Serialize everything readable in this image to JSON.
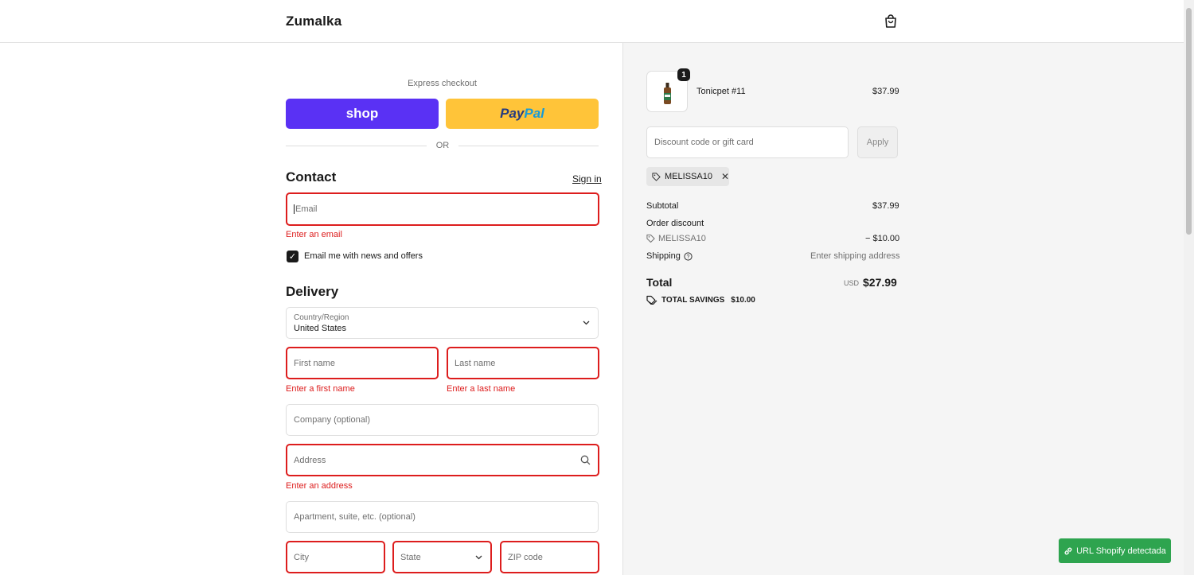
{
  "header": {
    "brand": "Zumalka",
    "cart_icon": "shopping-bag-icon"
  },
  "express": {
    "title": "Express checkout",
    "shop_label": "shop",
    "paypal_part1": "Pay",
    "paypal_part2": "Pal",
    "or_label": "OR"
  },
  "contact": {
    "heading": "Contact",
    "signin": "Sign in",
    "email_placeholder": "Email",
    "email_error": "Enter an email",
    "newsletter_label": "Email me with news and offers",
    "newsletter_checked": true
  },
  "delivery": {
    "heading": "Delivery",
    "country_label": "Country/Region",
    "country_value": "United States",
    "first_name": "First name",
    "first_name_error": "Enter a first name",
    "last_name": "Last name",
    "last_name_error": "Enter a last name",
    "company": "Company (optional)",
    "address": "Address",
    "address_error": "Enter an address",
    "apartment": "Apartment, suite, etc. (optional)",
    "city": "City",
    "state": "State",
    "zip": "ZIP code"
  },
  "summary": {
    "item": {
      "name": "Tonicpet #11",
      "price": "$37.99",
      "quantity": "1"
    },
    "discount_placeholder": "Discount code or gift card",
    "apply_label": "Apply",
    "applied_code": "MELISSA10",
    "subtotal_label": "Subtotal",
    "subtotal_value": "$37.99",
    "order_discount_label": "Order discount",
    "discount_code": "MELISSA10",
    "discount_value": "− $10.00",
    "shipping_label": "Shipping",
    "shipping_value": "Enter shipping address",
    "total_label": "Total",
    "currency": "USD",
    "total_value": "$27.99",
    "savings_label": "TOTAL SAVINGS",
    "savings_value": "$10.00"
  },
  "extension": {
    "label": "URL Shopify detectada"
  },
  "colors": {
    "shop_pay": "#5a31f4",
    "paypal": "#ffc439",
    "error": "#dd1d1d",
    "extension_green": "#2ea44f"
  }
}
